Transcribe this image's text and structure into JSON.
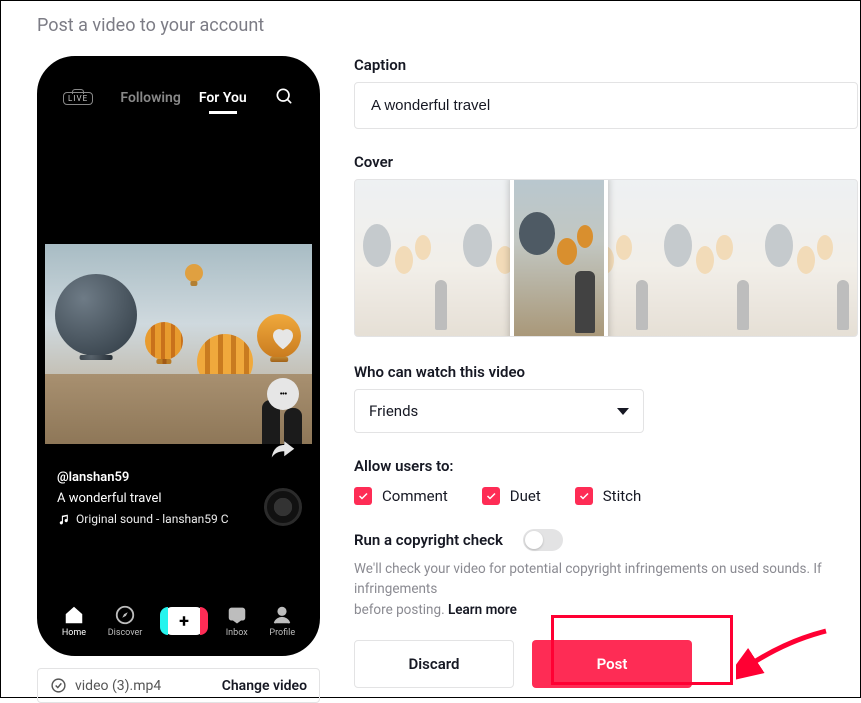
{
  "page": {
    "title": "Post a video to your account"
  },
  "preview": {
    "tabs": {
      "following": "Following",
      "foryou": "For You",
      "live": "LIVE"
    },
    "user": "@lanshan59",
    "caption": "A wonderful travel",
    "sound": "Original sound - lanshan59 C",
    "nav": {
      "home": "Home",
      "discover": "Discover",
      "inbox": "Inbox",
      "profile": "Profile"
    }
  },
  "file": {
    "name": "video (3).mp4",
    "change": "Change video"
  },
  "form": {
    "caption_label": "Caption",
    "caption_value": "A wonderful travel",
    "cover_label": "Cover",
    "audience_label": "Who can watch this video",
    "audience_value": "Friends",
    "allow_label": "Allow users to:",
    "allow": {
      "comment": "Comment",
      "duet": "Duet",
      "stitch": "Stitch"
    },
    "copyright_label": "Run a copyright check",
    "copyright_help": "We'll check your video for potential copyright infringements on used sounds. If infringements",
    "copyright_help2": "before posting.",
    "learn_more": "Learn more",
    "discard": "Discard",
    "post": "Post"
  }
}
